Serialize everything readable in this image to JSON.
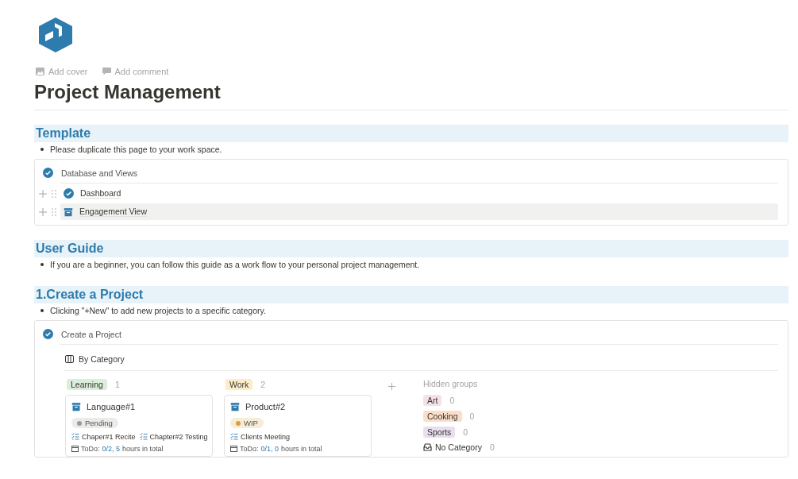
{
  "page": {
    "add_cover": "Add cover",
    "add_comment": "Add comment",
    "title": "Project Management"
  },
  "blocks": [
    {
      "kind": "heading",
      "text": "Template"
    },
    {
      "kind": "bullet",
      "text": "Please duplicate this page to your work space."
    },
    {
      "kind": "database_list",
      "title": "Database and Views",
      "items": [
        {
          "label": "Dashboard",
          "kind": "dashboard",
          "highlighted": false
        },
        {
          "label": "Engagement View",
          "kind": "database",
          "highlighted": true
        }
      ]
    },
    {
      "kind": "heading",
      "text": "User Guide"
    },
    {
      "kind": "bullet",
      "text": "If you are a beginner, you can follow this guide as a work flow to your personal project management."
    },
    {
      "kind": "heading",
      "text": "1.Create a Project"
    },
    {
      "kind": "bullet",
      "text": "Clicking \"+New\" to add new projects to a specific category."
    },
    {
      "kind": "board",
      "title": "Create a Project",
      "view": "By Category",
      "groups": [
        {
          "label": "Learning",
          "count": "1",
          "color": "#dbeddb",
          "cards": [
            {
              "title": "Language#1",
              "status": {
                "label": "Pending",
                "color": "#9b9a97"
              },
              "tasks": [
                "Chaper#1 Recite",
                "Chapter#2 Testing"
              ],
              "todo": {
                "label": "ToDo:",
                "value": "0/2, 5",
                "suffix": "hours in total"
              }
            }
          ]
        },
        {
          "label": "Work",
          "count": "2",
          "color": "#fdecc8",
          "cards": [
            {
              "title": "Product#2",
              "status": {
                "label": "WIP",
                "color": "#d9a03c"
              },
              "tasks": [
                "Clients Meeting"
              ],
              "todo": {
                "label": "ToDo:",
                "value": "0/1, 0",
                "suffix": "hours in total"
              }
            }
          ]
        }
      ],
      "hidden_title": "Hidden groups",
      "hidden": [
        {
          "label": "Art",
          "count": "0",
          "color": "#f5e0e9"
        },
        {
          "label": "Cooking",
          "count": "0",
          "color": "#fadec9"
        },
        {
          "label": "Sports",
          "count": "0",
          "color": "#e8deee"
        }
      ],
      "no_category": {
        "label": "No Category",
        "count": "0"
      }
    }
  ]
}
